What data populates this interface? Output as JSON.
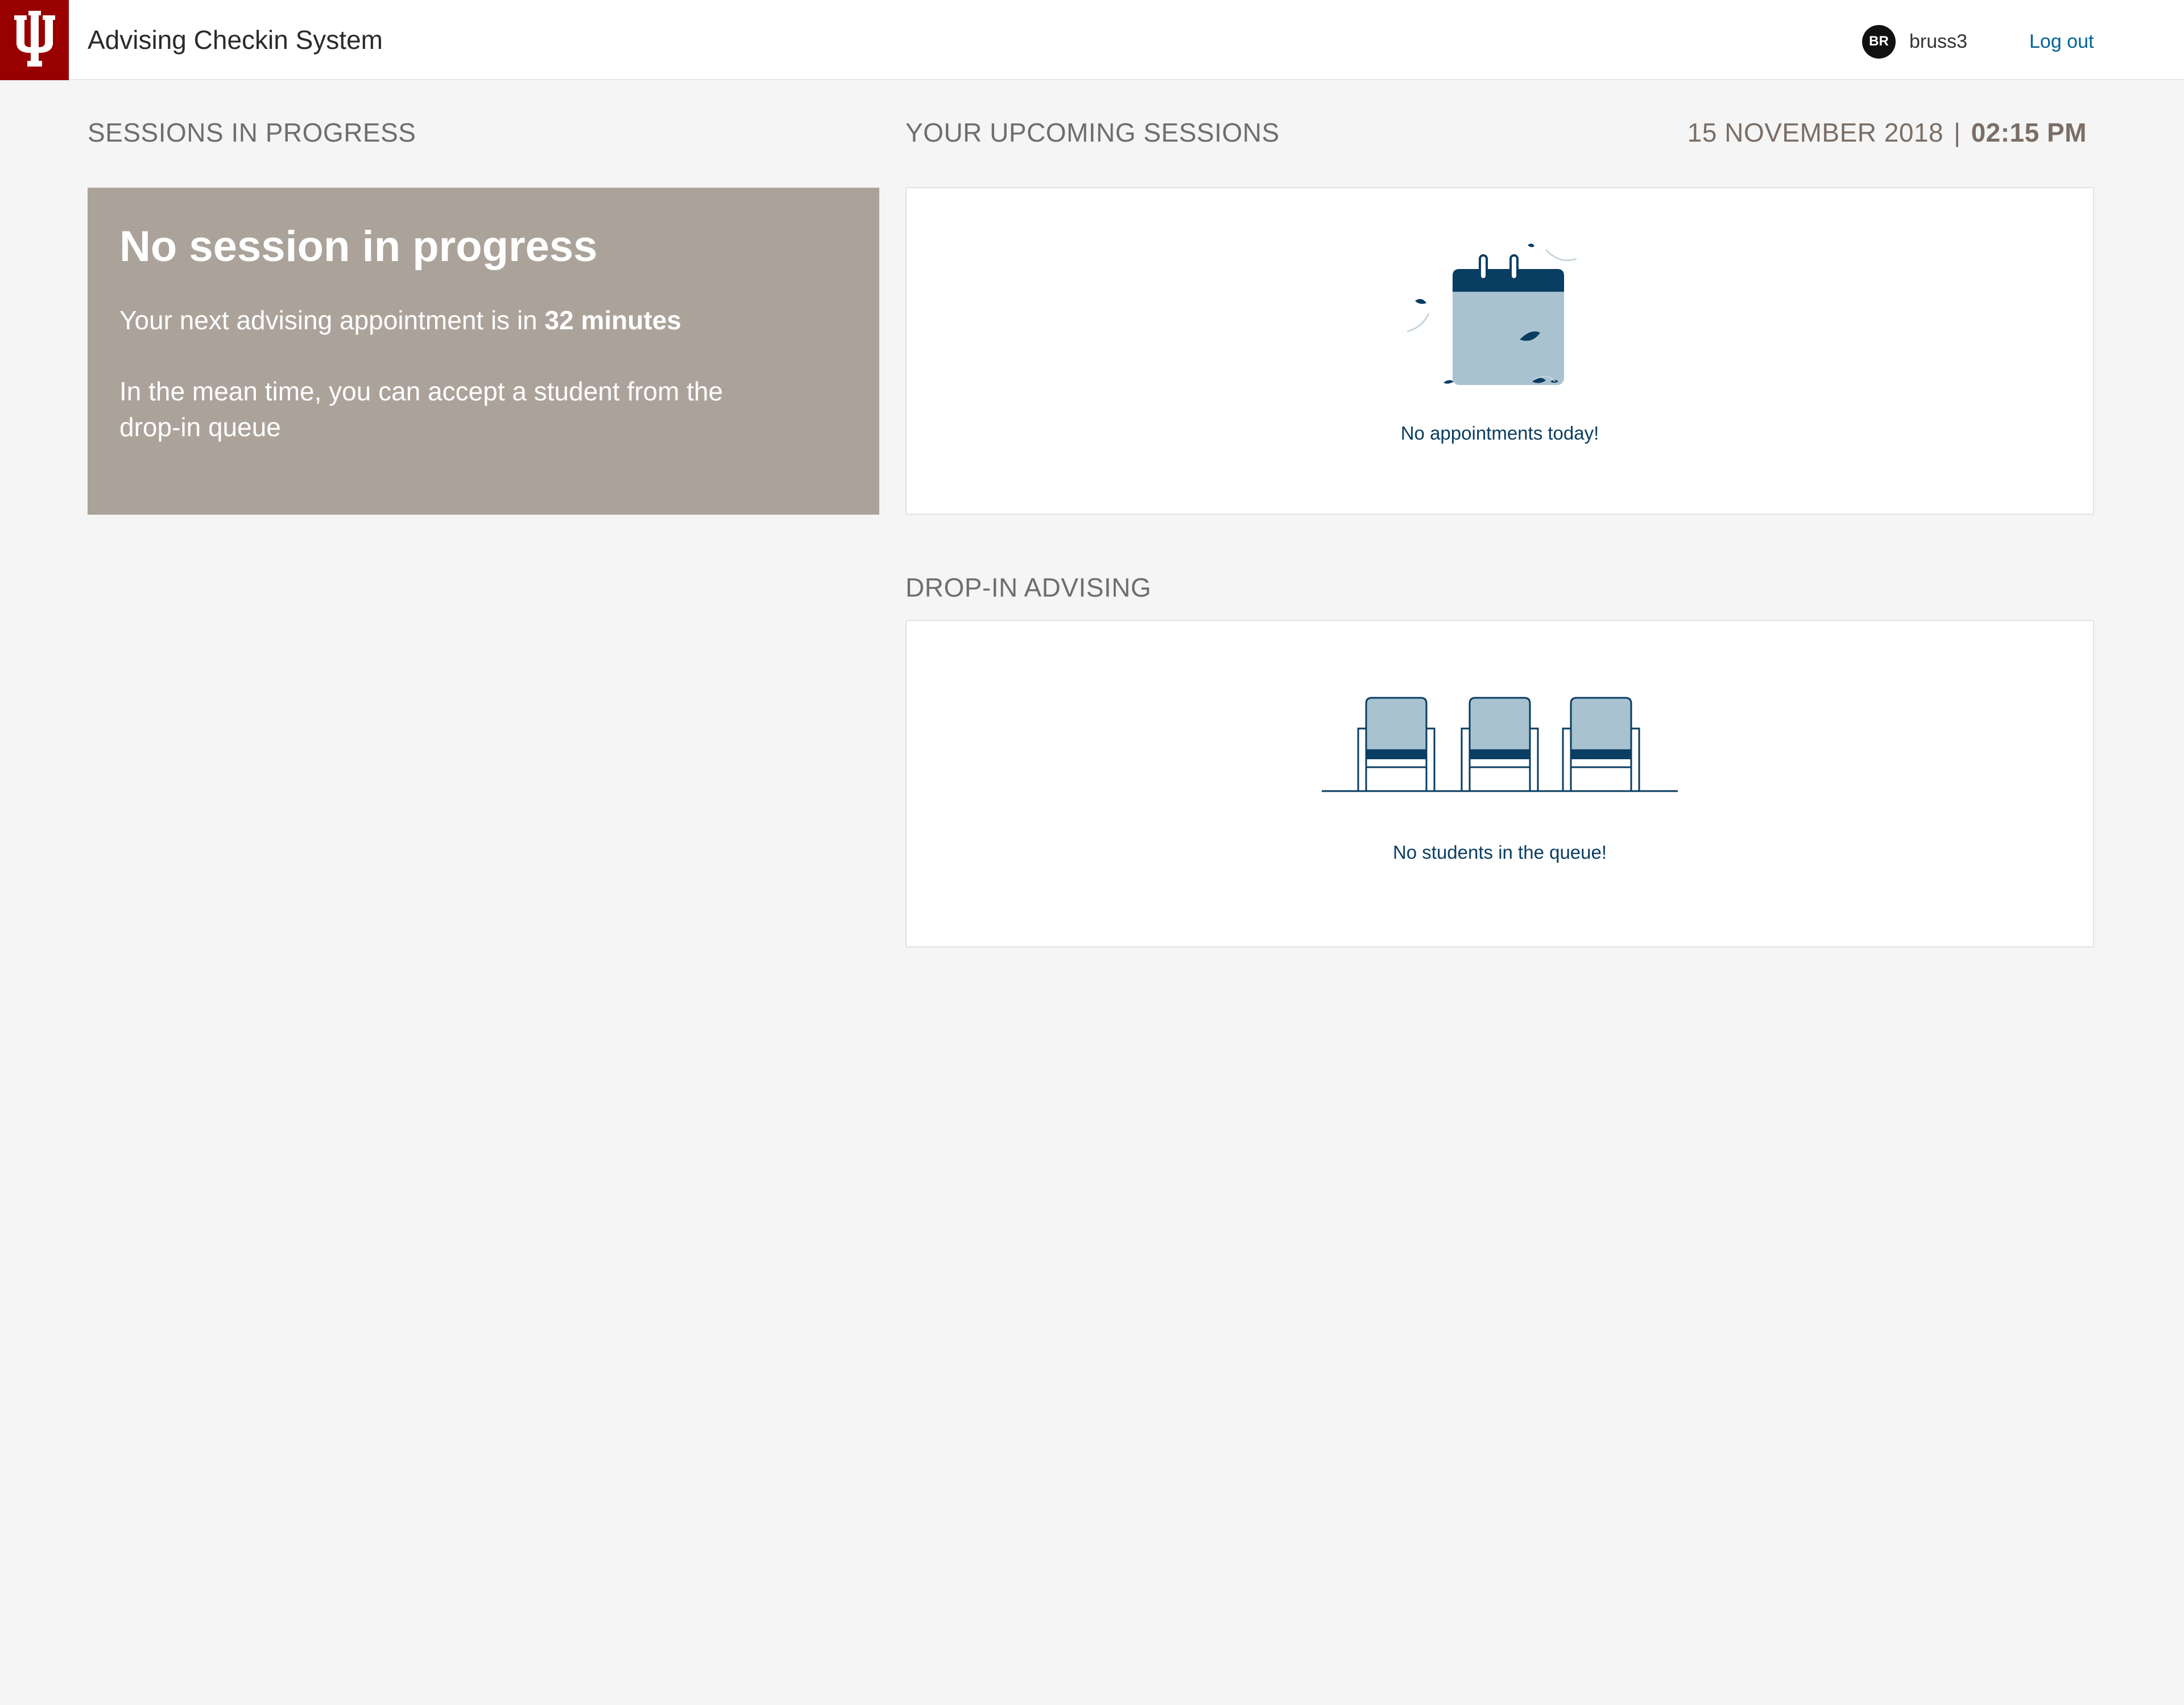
{
  "header": {
    "app_title": "Advising Checkin System",
    "logo_icon": "iu-trident-logo",
    "user": {
      "initials": "BR",
      "username": "bruss3"
    },
    "logout_label": "Log out"
  },
  "sections": {
    "in_progress_heading": "SESSIONS IN PROGRESS",
    "upcoming_heading": "YOUR UPCOMING SESSIONS",
    "dropin_heading": "DROP-IN ADVISING"
  },
  "datetime": {
    "date": "15 NOVEMBER 2018",
    "separator": "|",
    "time": "02:15 PM"
  },
  "progress_card": {
    "title": "No session in progress",
    "next_prefix": "Your next advising appointment is in ",
    "next_value": "32 minutes",
    "meantime": "In the mean time, you can accept a student from the drop-in queue"
  },
  "upcoming_panel": {
    "icon": "calendar-icon",
    "message": "No appointments today!"
  },
  "dropin_panel": {
    "icon": "waiting-chairs-icon",
    "message": "No students in the queue!"
  },
  "colors": {
    "brand_crimson": "#990000",
    "card_taupe": "#aba39a",
    "link_blue": "#006298",
    "navy": "#0a3d62",
    "light_blue": "#a8c2d0"
  }
}
